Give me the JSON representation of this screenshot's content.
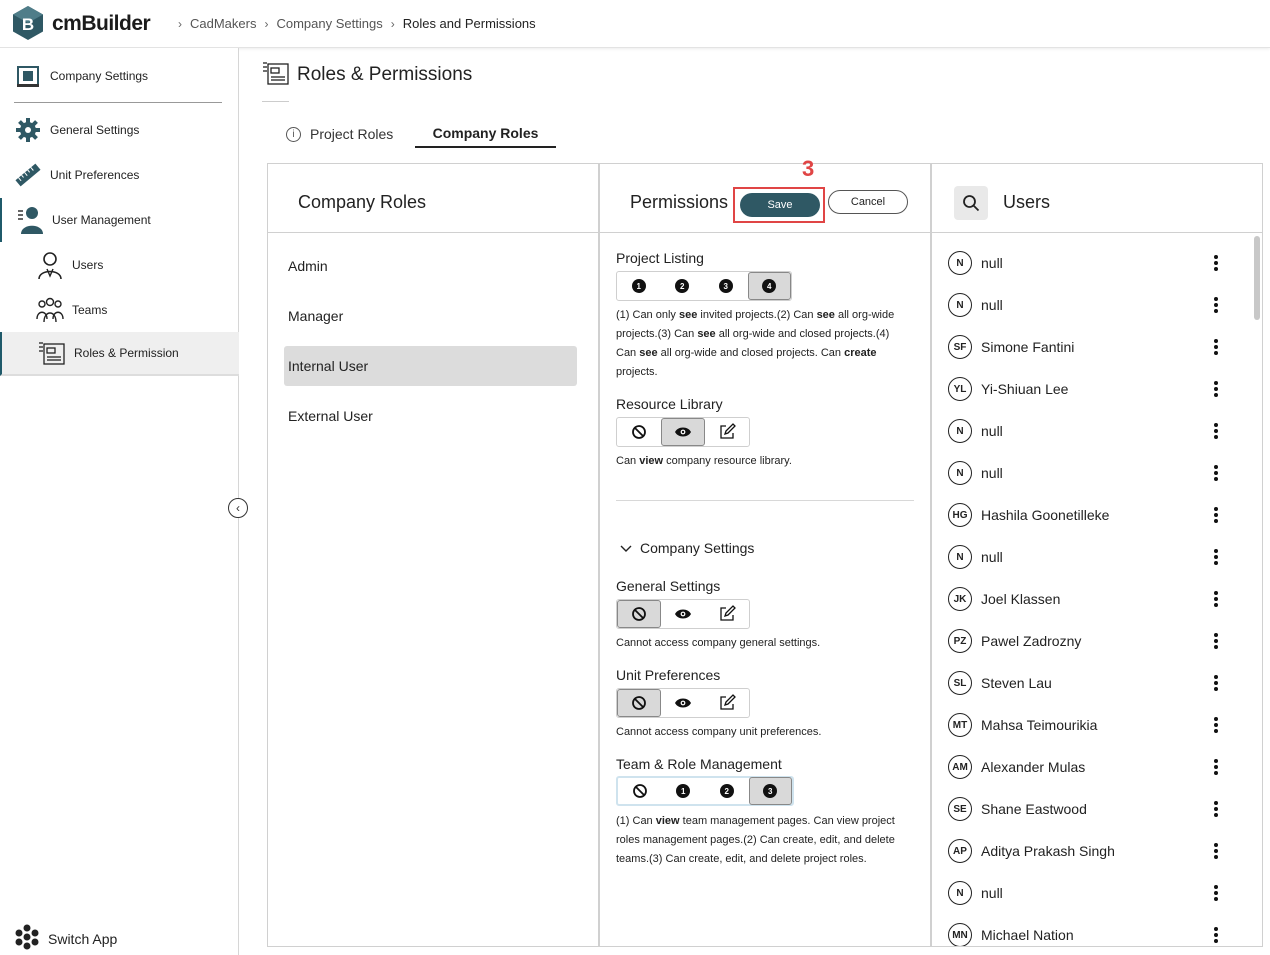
{
  "app": {
    "brand": "cmBuilder",
    "logo_letter": "B"
  },
  "breadcrumb": [
    "CadMakers",
    "Company Settings",
    "Roles and Permissions"
  ],
  "sidebar": {
    "items": [
      {
        "label": "Company Settings",
        "icon": "company-settings-icon"
      },
      {
        "label": "General Settings",
        "icon": "gear-icon"
      },
      {
        "label": "Unit Preferences",
        "icon": "ruler-icon"
      },
      {
        "label": "User Management",
        "icon": "user-management-icon"
      },
      {
        "label": "Users",
        "icon": "user-icon"
      },
      {
        "label": "Teams",
        "icon": "team-icon"
      },
      {
        "label": "Roles & Permission",
        "icon": "roles-icon"
      }
    ],
    "switch_app": "Switch App"
  },
  "page": {
    "title": "Roles & Permissions"
  },
  "tabs": {
    "project": "Project Roles",
    "company": "Company Roles"
  },
  "roles_panel": {
    "title": "Company Roles",
    "roles": [
      "Admin",
      "Manager",
      "Internal User",
      "External User"
    ],
    "selected": "Internal User"
  },
  "permissions_panel": {
    "title": "Permissions",
    "save": "Save",
    "cancel": "Cancel",
    "step_marker": "3",
    "project_listing": {
      "title": "Project Listing",
      "options": [
        "1",
        "2",
        "3",
        "4"
      ],
      "selected": "4",
      "desc": [
        "(1) Can only ",
        "see",
        " invited projects.(2) Can ",
        "see",
        " all org-wide projects.(3) Can ",
        "see",
        " all org-wide and closed projects.(4) Can ",
        "see",
        " all org-wide and closed projects. Can ",
        "create",
        " projects."
      ]
    },
    "resource_library": {
      "title": "Resource Library",
      "selected": "view",
      "desc": [
        "Can ",
        "view",
        " company resource library."
      ]
    },
    "company_settings_group": "Company Settings",
    "general_settings": {
      "title": "General Settings",
      "selected": "none",
      "desc": "Cannot access company general settings."
    },
    "unit_preferences": {
      "title": "Unit Preferences",
      "selected": "none",
      "desc": "Cannot access company unit preferences."
    },
    "team_role_management": {
      "title": "Team & Role Management",
      "options": [
        "1",
        "2",
        "3"
      ],
      "selected": "3",
      "desc": [
        "(1) Can ",
        "view",
        " team management pages. Can view project roles management pages.(2) Can create, edit, and delete teams.(3) Can create, edit, and delete project roles."
      ]
    }
  },
  "users_panel": {
    "title": "Users",
    "users": [
      {
        "initials": "N",
        "name": "null"
      },
      {
        "initials": "N",
        "name": "null"
      },
      {
        "initials": "SF",
        "name": "Simone Fantini"
      },
      {
        "initials": "YL",
        "name": "Yi-Shiuan Lee"
      },
      {
        "initials": "N",
        "name": "null"
      },
      {
        "initials": "N",
        "name": "null"
      },
      {
        "initials": "HG",
        "name": "Hashila Goonetilleke"
      },
      {
        "initials": "N",
        "name": "null"
      },
      {
        "initials": "JK",
        "name": "Joel Klassen"
      },
      {
        "initials": "PZ",
        "name": "Pawel Zadrozny"
      },
      {
        "initials": "SL",
        "name": "Steven Lau"
      },
      {
        "initials": "MT",
        "name": "Mahsa Teimourikia"
      },
      {
        "initials": "AM",
        "name": "Alexander Mulas"
      },
      {
        "initials": "SE",
        "name": "Shane Eastwood"
      },
      {
        "initials": "AP",
        "name": "Aditya Prakash Singh"
      },
      {
        "initials": "N",
        "name": "null"
      },
      {
        "initials": "MN",
        "name": "Michael Nation"
      }
    ]
  },
  "colors": {
    "accent": "#2f5864",
    "highlight": "#e04545",
    "selected_bg": "#dcdcdc"
  }
}
